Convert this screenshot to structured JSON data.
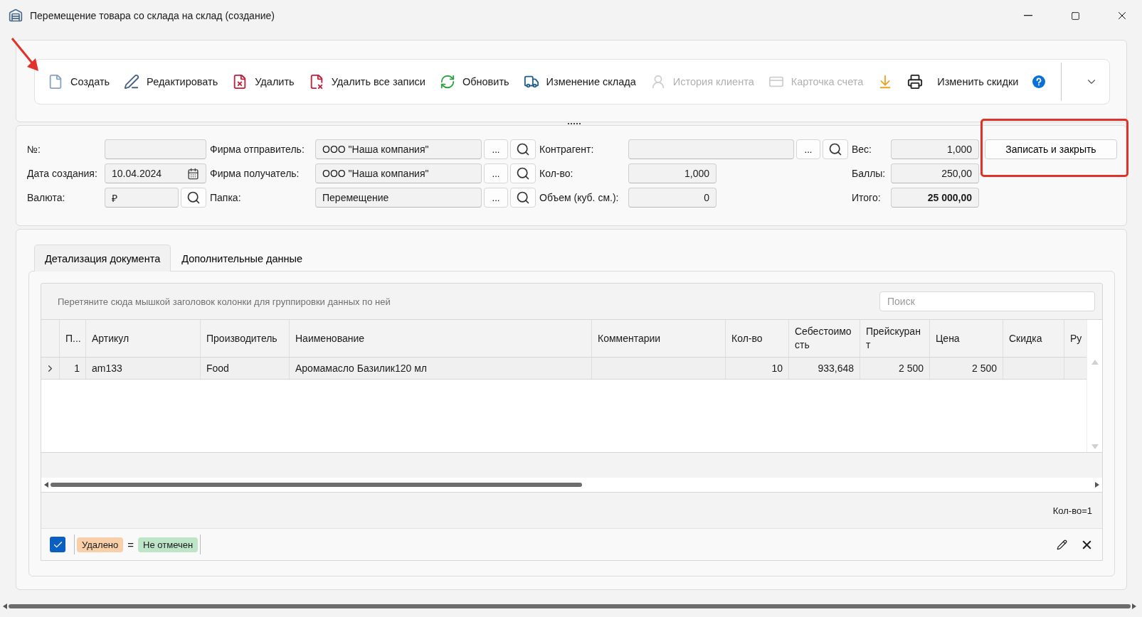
{
  "window": {
    "title": "Перемещение товара со склада на склад (создание)"
  },
  "toolbar": {
    "items": [
      {
        "label": "Создать",
        "disabled": false
      },
      {
        "label": "Редактировать",
        "disabled": false
      },
      {
        "label": "Удалить",
        "disabled": false
      },
      {
        "label": "Удалить все записи",
        "disabled": false
      },
      {
        "label": "Обновить",
        "disabled": false
      },
      {
        "label": "Изменение склада",
        "disabled": false
      },
      {
        "label": "История клиента",
        "disabled": true
      },
      {
        "label": "Карточка счета",
        "disabled": true
      },
      {
        "disabled": false
      },
      {
        "disabled": false
      },
      {
        "label": "Изменить скидки",
        "disabled": false
      },
      {
        "disabled": false
      }
    ]
  },
  "form": {
    "rows": [
      [
        {
          "label": "№:",
          "kind": "text"
        },
        {
          "label": "Фирма отправитель:",
          "value": "ООО \"Наша компания\"",
          "kind": "picker",
          "button": "..."
        },
        {
          "label": "Контрагент:",
          "kind": "picker",
          "button": "..."
        },
        {
          "label": "Вес:",
          "value": "1,000",
          "kind": "number"
        }
      ],
      [
        {
          "label": "Дата создания:",
          "value": "10.04.2024",
          "kind": "date"
        },
        {
          "label": "Фирма получатель:",
          "value": "ООО \"Наша компания\"",
          "kind": "picker",
          "button": "..."
        },
        {
          "label": "Кол-во:",
          "value": "1,000",
          "kind": "number"
        },
        {
          "label": "Баллы:",
          "value": "250,00",
          "kind": "number"
        }
      ],
      [
        {
          "label": "Валюта:",
          "value": "₽",
          "kind": "lookup"
        },
        {
          "label": "Папка:",
          "value": "Перемещение",
          "kind": "picker",
          "button": "..."
        },
        {
          "label": "Объем (куб. см.):",
          "value": "0",
          "kind": "number"
        },
        {
          "label": "Итого:",
          "value": "25 000,00",
          "kind": "total"
        }
      ]
    ],
    "save_button": "Записать и закрыть"
  },
  "tabs": [
    {
      "label": "Детализация документа",
      "selected": true
    },
    {
      "label": "Дополнительные данные",
      "selected": false
    }
  ],
  "grid": {
    "group_hint": "Перетяните сюда мышкой заголовок колонки для группировки данных по ней",
    "search": {
      "placeholder": "Поиск"
    },
    "columns": [
      {
        "label": "П...",
        "kind": "number"
      },
      {
        "label": "Артикул",
        "kind": "text"
      },
      {
        "label": "Производитель",
        "kind": "text"
      },
      {
        "label": "Наименование",
        "kind": "text"
      },
      {
        "label": "Комментарии",
        "kind": "text"
      },
      {
        "label": "Кол-во",
        "kind": "number"
      },
      {
        "label": "Себестоимость",
        "kind": "number"
      },
      {
        "label": "Прейскурант",
        "kind": "number"
      },
      {
        "label": "Цена",
        "kind": "number"
      },
      {
        "label": "Скидка",
        "kind": "number"
      },
      {
        "label": "Ру",
        "kind": "text"
      }
    ],
    "rows": [
      {
        "expanded": false,
        "cells": [
          "1",
          "am133",
          "Food",
          "Аромамасло Базилик120 мл",
          "",
          "10",
          "933,648",
          "2 500",
          "2 500",
          "",
          ""
        ]
      }
    ],
    "summary": "Кол-во=1",
    "filter": {
      "checked": true,
      "field": "Удалено",
      "operator": "=",
      "value": "Не отмечен"
    }
  }
}
